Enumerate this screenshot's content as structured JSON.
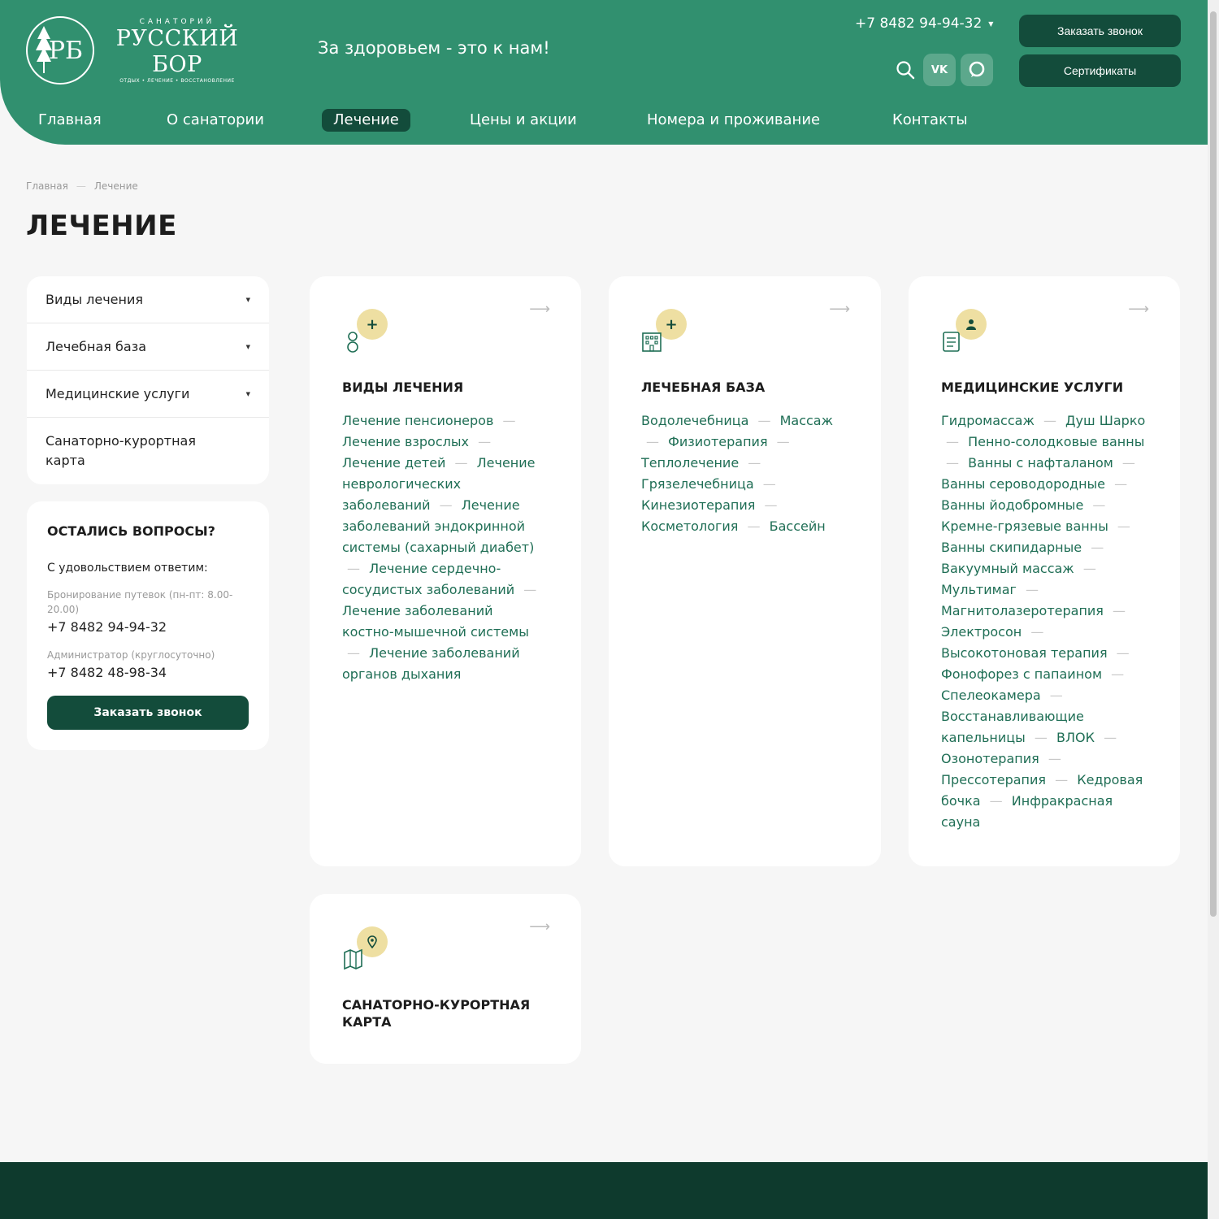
{
  "header": {
    "logo_sub1": "САНАТОРИЙ",
    "logo_main": "РУССКИЙ БОР",
    "logo_sub2": "ОТДЫХ • ЛЕЧЕНИЕ • ВОССТАНОВЛЕНИЕ",
    "logo_monogram": "РБ",
    "slogan": "За здоровьем - это к нам!",
    "phone": "+7 8482 94-94-32",
    "call_button": "Заказать звонок",
    "certificates_button": "Сертификаты",
    "vk_label": "VK",
    "colors": {
      "header_bg": "#31906f",
      "button_dark": "#134c3b",
      "badge": "#eedfa2"
    }
  },
  "nav": [
    {
      "label": "Главная"
    },
    {
      "label": "О санатории"
    },
    {
      "label": "Лечение",
      "active": true
    },
    {
      "label": "Цены и акции"
    },
    {
      "label": "Номера и проживание"
    },
    {
      "label": "Контакты"
    }
  ],
  "breadcrumb": {
    "home": "Главная",
    "current": "Лечение"
  },
  "page_title": "ЛЕЧЕНИЕ",
  "side_menu": [
    {
      "label": "Виды лечения"
    },
    {
      "label": "Лечебная база"
    },
    {
      "label": "Медицинские услуги"
    },
    {
      "label": "Санаторно-курортная карта"
    }
  ],
  "questions": {
    "title": "ОСТАЛИСЬ ВОПРОСЫ?",
    "subtitle": "С удовольствием ответим:",
    "booking_label": "Бронирование путевок (пн-пт: 8.00-20.00)",
    "booking_phone": "+7 8482 94-94-32",
    "admin_label": "Администратор (круглосуточно)",
    "admin_phone": "+7 8482 48-98-34",
    "button": "Заказать звонок"
  },
  "cards": [
    {
      "title": "ВИДЫ ЛЕЧЕНИЯ",
      "icon": "person-plus-icon",
      "links": [
        "Лечение пенсионеров",
        "Лечение взрослых",
        "Лечение детей",
        "Лечение неврологических заболеваний",
        "Лечение заболеваний эндокринной системы (сахарный диабет)",
        "Лечение сердечно-сосудистых заболеваний",
        "Лечение заболеваний костно-мышечной системы",
        "Лечение заболеваний органов дыхания"
      ]
    },
    {
      "title": "ЛЕЧЕБНАЯ БАЗА",
      "icon": "building-plus-icon",
      "links": [
        "Водолечебница",
        "Массаж",
        "Физиотерапия",
        "Теплолечение",
        "Грязелечебница",
        "Кинезиотерапия",
        "Косметология",
        "Бассейн"
      ]
    },
    {
      "title": "МЕДИЦИНСКИЕ УСЛУГИ",
      "icon": "document-doctor-icon",
      "links": [
        "Гидромассаж",
        "Душ Шарко",
        "Пенно-солодковые ванны",
        "Ванны с нафталаном",
        "Ванны сероводородные",
        "Ванны йодобромные",
        "Кремне-грязевые ванны",
        "Ванны скипидарные",
        "Вакуумный массаж",
        "Мультимаг",
        "Магнитолазеротерапия",
        "Электросон",
        "Высокотоновая терапия",
        "Фонофорез с папаином",
        "Спелеокамера",
        "Восстанавливающие капельницы",
        "ВЛОК",
        "Озонотерапия",
        "Прессотерапия",
        "Кедровая бочка",
        "Инфракрасная сауна"
      ]
    },
    {
      "title": "САНАТОРНО-КУРОРТНАЯ КАРТА",
      "icon": "map-pin-icon",
      "links": []
    }
  ]
}
